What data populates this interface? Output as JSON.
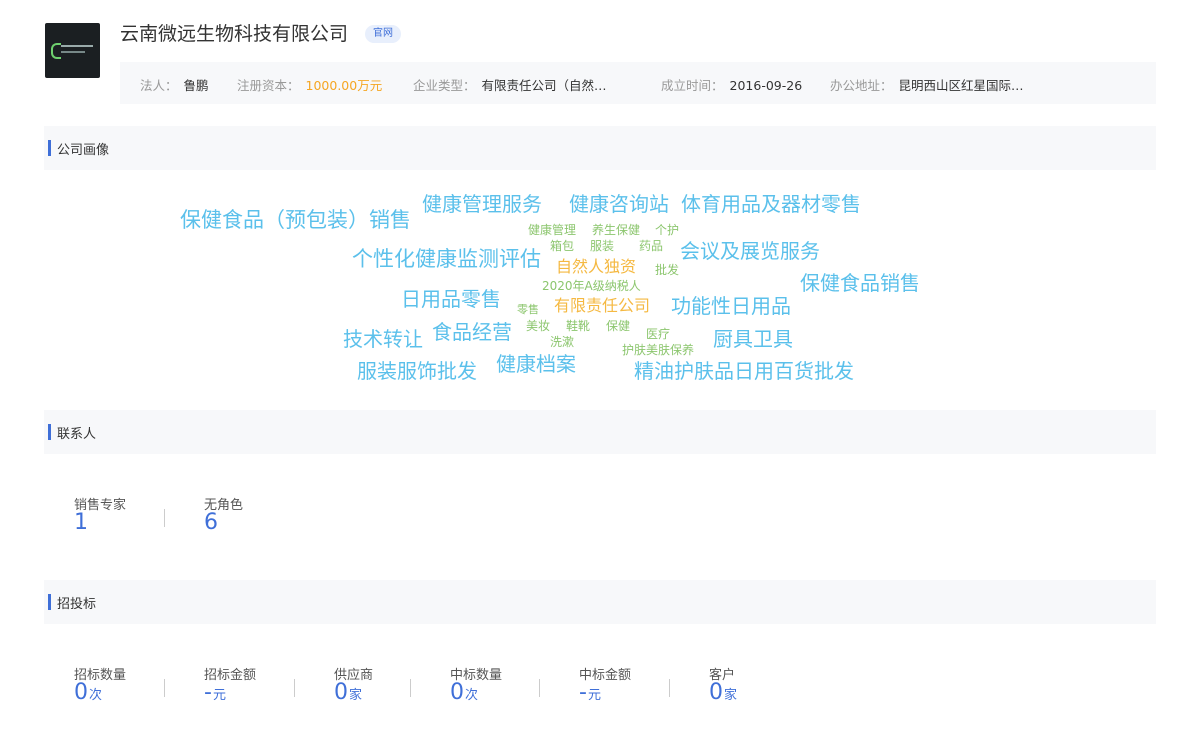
{
  "header": {
    "company_name": "云南微远生物科技有限公司",
    "official_badge": "官网",
    "info": [
      {
        "label": "法人：",
        "value": "鲁鹏"
      },
      {
        "label": "注册资本：",
        "value": "1000.00万元"
      },
      {
        "label": "企业类型：",
        "value": "有限责任公司（自然…"
      },
      {
        "label": "成立时间：",
        "value": "2016-09-26"
      },
      {
        "label": "办公地址：",
        "value": "昆明西山区红星国际…"
      }
    ]
  },
  "sections": {
    "portrait": "公司画像",
    "contacts": "联系人",
    "bidding": "招投标"
  },
  "word_cloud": [
    {
      "text": "保健食品（预包装）销售",
      "color": "#5bc0eb"
    },
    {
      "text": "健康管理服务",
      "color": "#5bc0eb"
    },
    {
      "text": "健康咨询站",
      "color": "#5bc0eb"
    },
    {
      "text": "体育用品及器材零售",
      "color": "#5bc0eb"
    },
    {
      "text": "健康管理",
      "color": "#8cc66e"
    },
    {
      "text": "养生保健",
      "color": "#8cc66e"
    },
    {
      "text": "个护",
      "color": "#8cc66e"
    },
    {
      "text": "箱包",
      "color": "#8cc66e"
    },
    {
      "text": "服装",
      "color": "#8cc66e"
    },
    {
      "text": "药品",
      "color": "#8cc66e"
    },
    {
      "text": "会议及展览服务",
      "color": "#5bc0eb"
    },
    {
      "text": "个性化健康监测评估",
      "color": "#5bc0eb"
    },
    {
      "text": "自然人独资",
      "color": "#f5b942"
    },
    {
      "text": "批发",
      "color": "#8cc66e"
    },
    {
      "text": "保健食品销售",
      "color": "#5bc0eb"
    },
    {
      "text": "2020年A级纳税人",
      "color": "#8cc66e"
    },
    {
      "text": "日用品零售",
      "color": "#5bc0eb"
    },
    {
      "text": "零售",
      "color": "#8cc66e"
    },
    {
      "text": "有限责任公司",
      "color": "#f5b942"
    },
    {
      "text": "功能性日用品",
      "color": "#5bc0eb"
    },
    {
      "text": "技术转让",
      "color": "#5bc0eb"
    },
    {
      "text": "食品经营",
      "color": "#5bc0eb"
    },
    {
      "text": "美妆",
      "color": "#8cc66e"
    },
    {
      "text": "鞋靴",
      "color": "#8cc66e"
    },
    {
      "text": "保健",
      "color": "#8cc66e"
    },
    {
      "text": "洗漱",
      "color": "#8cc66e"
    },
    {
      "text": "医疗",
      "color": "#8cc66e"
    },
    {
      "text": "护肤美肤保养",
      "color": "#8cc66e"
    },
    {
      "text": "厨具卫具",
      "color": "#5bc0eb"
    },
    {
      "text": "服装服饰批发",
      "color": "#5bc0eb"
    },
    {
      "text": "健康档案",
      "color": "#5bc0eb"
    },
    {
      "text": "精油护肤品日用百货批发",
      "color": "#5bc0eb"
    }
  ],
  "contacts": [
    {
      "label": "销售专家",
      "value": "1"
    },
    {
      "label": "无角色",
      "value": "6"
    }
  ],
  "bidding": [
    {
      "label": "招标数量",
      "value": "0",
      "unit": "次"
    },
    {
      "label": "招标金额",
      "value": "-",
      "unit": "元"
    },
    {
      "label": "供应商",
      "value": "0",
      "unit": "家"
    },
    {
      "label": "中标数量",
      "value": "0",
      "unit": "次"
    },
    {
      "label": "中标金额",
      "value": "-",
      "unit": "元"
    },
    {
      "label": "客户",
      "value": "0",
      "unit": "家"
    }
  ]
}
